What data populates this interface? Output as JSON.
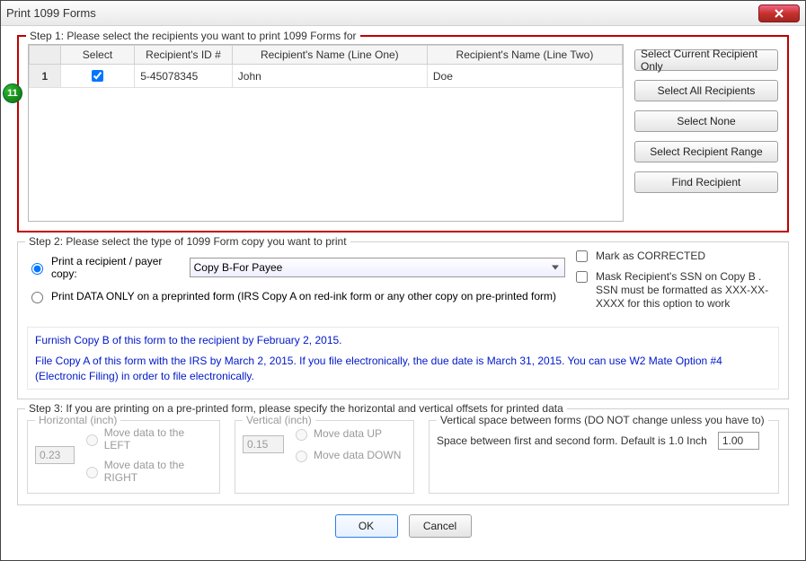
{
  "window": {
    "title": "Print 1099 Forms"
  },
  "badge": "11",
  "step1": {
    "title": "Step 1: Please select the recipients you want to print 1099 Forms for",
    "headers": {
      "select": "Select",
      "id": "Recipient's ID #",
      "name1": "Recipient's Name (Line One)",
      "name2": "Recipient's Name (Line Two)"
    },
    "rows": [
      {
        "num": "1",
        "id": "5-45078345",
        "name1": "John",
        "name2": "Doe"
      }
    ],
    "buttons": {
      "current": "Select Current Recipient Only",
      "all": "Select All Recipients",
      "none": "Select None",
      "range": "Select Recipient Range",
      "find": "Find Recipient"
    }
  },
  "step2": {
    "title": "Step 2: Please select the type of 1099 Form copy you want to print",
    "print_copy_label": "Print a recipient / payer copy:",
    "copy_value": "Copy B-For Payee",
    "print_data_only": "Print DATA ONLY on a preprinted form (IRS Copy A on red-ink form or any other copy on pre-printed form)",
    "mark_corrected": "Mark as CORRECTED",
    "mask_ssn": "Mask Recipient's SSN on Copy B . SSN must be formatted as XXX-XX-XXXX for this option to work",
    "note1": "Furnish Copy B of this form to the recipient by February 2, 2015.",
    "note2": "File Copy A of this form with the IRS by March 2, 2015. If you file electronically, the due date is March 31, 2015. You can use W2 Mate Option #4 (Electronic Filing) in order to file electronically."
  },
  "step3": {
    "title": "Step 3: If you are printing on a pre-printed form, please specify the horizontal and vertical offsets for printed data",
    "horiz": {
      "title": "Horizontal (inch)",
      "value": "0.23",
      "left": "Move data to the LEFT",
      "right": "Move data to the RIGHT"
    },
    "vert": {
      "title": "Vertical (inch)",
      "value": "0.15",
      "up": "Move data UP",
      "down": "Move data DOWN"
    },
    "vspace": {
      "title": "Vertical space between forms (DO NOT change unless you have to)",
      "desc": "Space between first and second form. Default is 1.0 Inch",
      "value": "1.00"
    }
  },
  "footer": {
    "ok": "OK",
    "cancel": "Cancel"
  }
}
